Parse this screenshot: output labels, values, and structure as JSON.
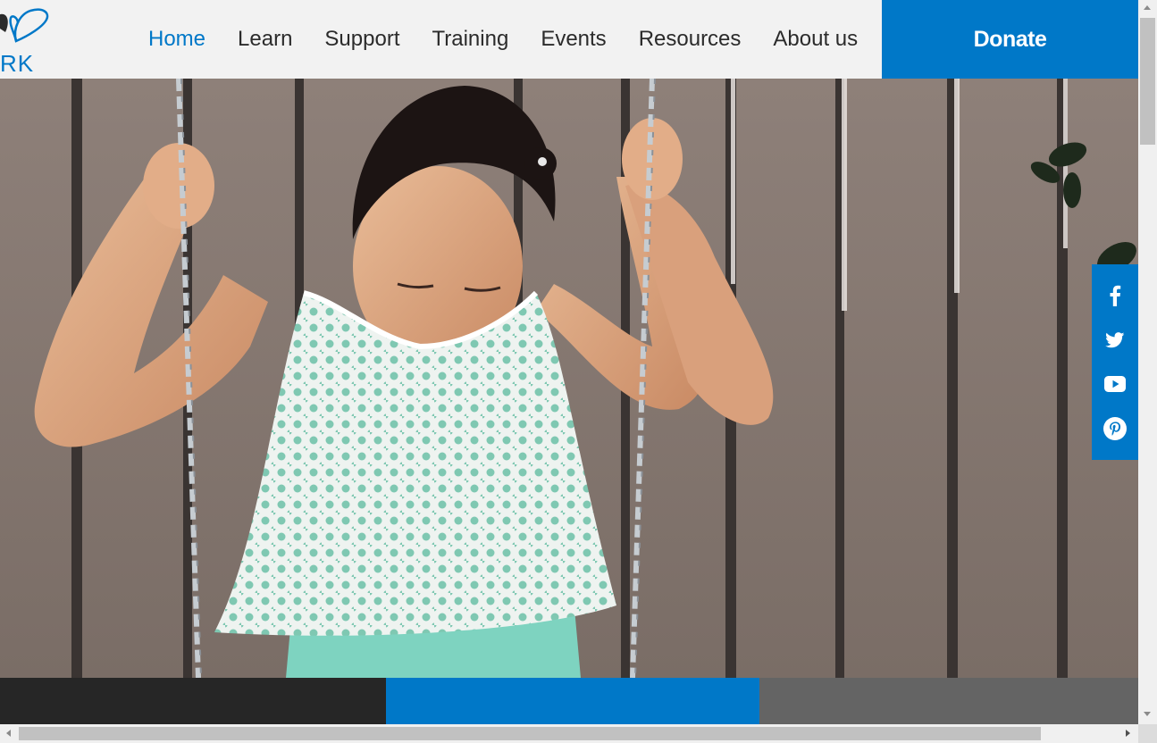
{
  "header": {
    "logo_text": "RK",
    "nav": [
      {
        "label": "Home",
        "active": true
      },
      {
        "label": "Learn",
        "active": false
      },
      {
        "label": "Support",
        "active": false
      },
      {
        "label": "Training",
        "active": false
      },
      {
        "label": "Events",
        "active": false
      },
      {
        "label": "Resources",
        "active": false
      },
      {
        "label": "About us",
        "active": false
      }
    ],
    "donate_label": "Donate"
  },
  "hero": {
    "image": "girl-on-swing-photo"
  },
  "social": [
    {
      "icon": "facebook-icon"
    },
    {
      "icon": "twitter-icon"
    },
    {
      "icon": "youtube-icon"
    },
    {
      "icon": "pinterest-icon"
    }
  ],
  "colors": {
    "brand_blue": "#0078c8",
    "nav_text": "#2b2b2b",
    "header_bg": "#f2f2f2",
    "band_dark": "#262626",
    "band_gray": "#646464"
  }
}
